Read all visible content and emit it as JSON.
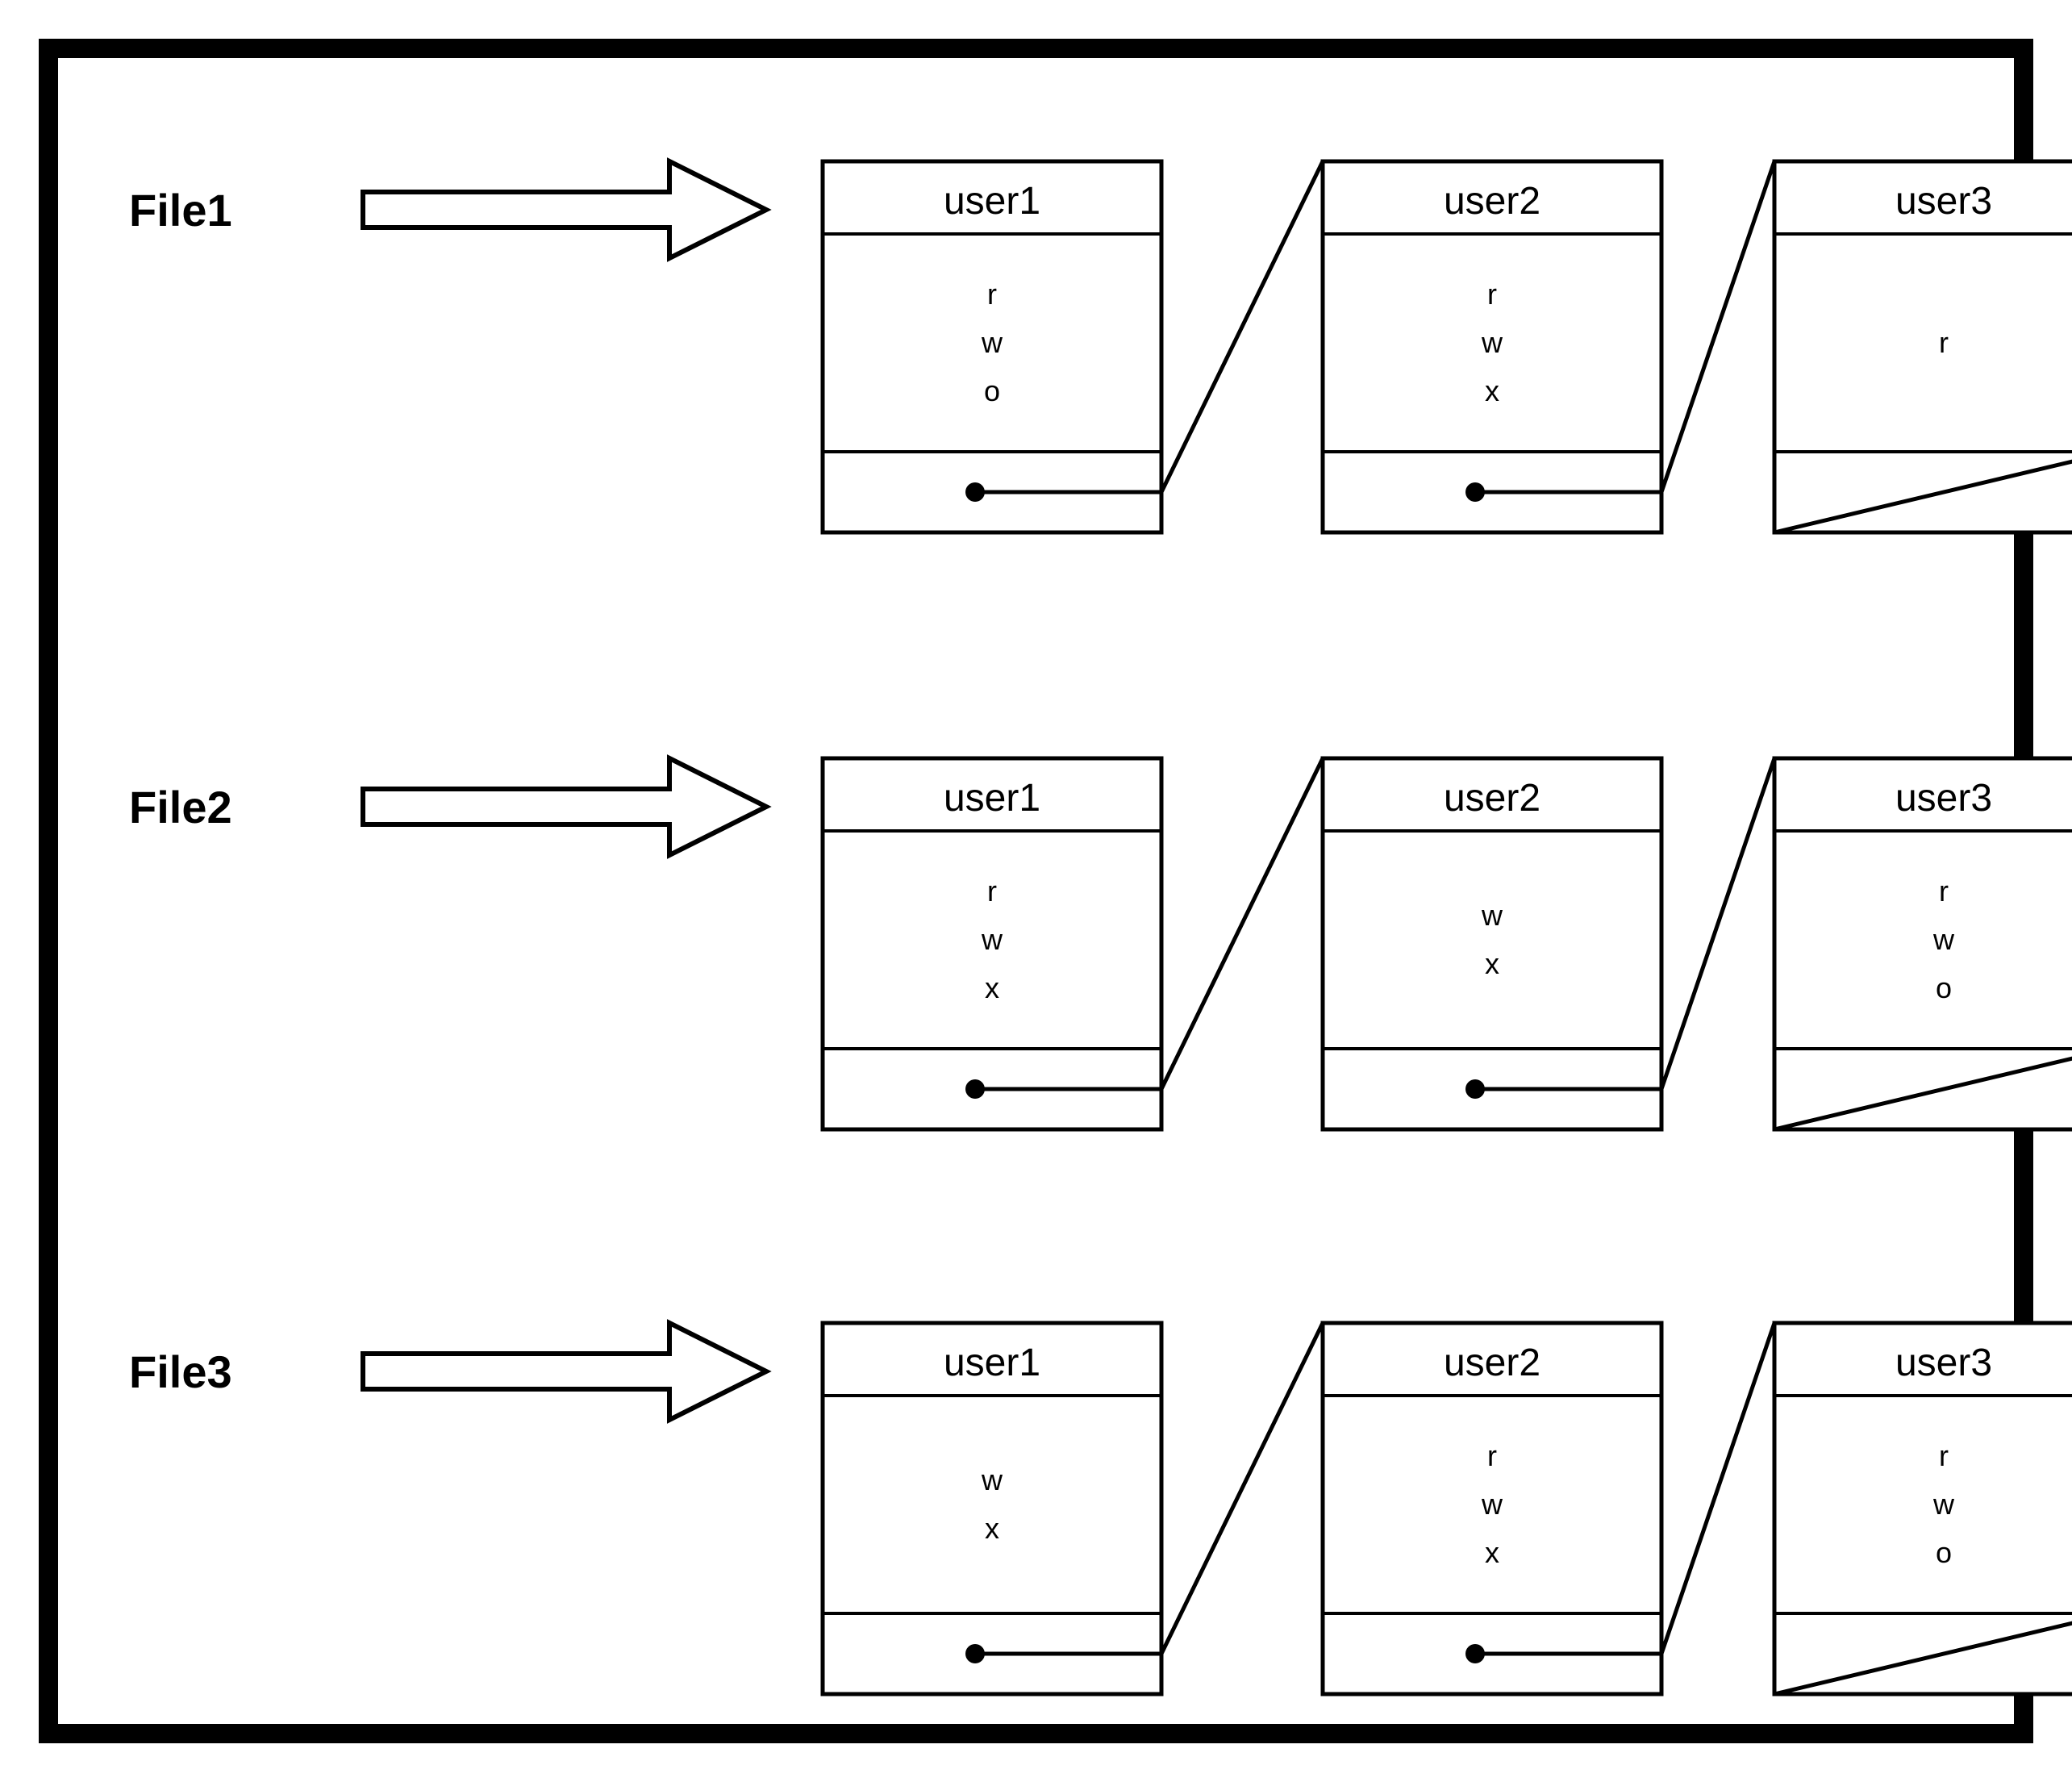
{
  "rows": [
    {
      "file": "File1",
      "nodes": [
        {
          "user": "user1",
          "perms": [
            "r",
            "w",
            "o"
          ]
        },
        {
          "user": "user2",
          "perms": [
            "r",
            "w",
            "x"
          ]
        },
        {
          "user": "user3",
          "perms": [
            "r"
          ]
        }
      ]
    },
    {
      "file": "File2",
      "nodes": [
        {
          "user": "user1",
          "perms": [
            "r",
            "w",
            "x"
          ]
        },
        {
          "user": "user2",
          "perms": [
            "w",
            "x"
          ]
        },
        {
          "user": "user3",
          "perms": [
            "r",
            "w",
            "o"
          ]
        }
      ]
    },
    {
      "file": "File3",
      "nodes": [
        {
          "user": "user1",
          "perms": [
            "w",
            "x"
          ]
        },
        {
          "user": "user2",
          "perms": [
            "r",
            "w",
            "x"
          ]
        },
        {
          "user": "user3",
          "perms": [
            "r",
            "w",
            "o"
          ]
        }
      ]
    }
  ]
}
